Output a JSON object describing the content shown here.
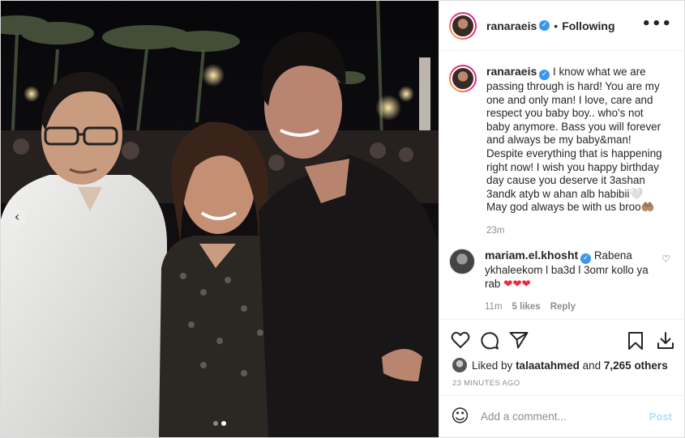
{
  "post": {
    "username": "ranaraeis",
    "separator": "•",
    "follow_status": "Following",
    "more_icon": "more-horizontal-icon"
  },
  "caption": {
    "username": "ranaraeis",
    "text": "I know what we are passing through is hard! You are my one and only man! I love, care and respect you baby boy.. who's not baby anymore. Bass you will forever and always be my baby&man! Despite everything that is happening right now! I wish you happy birthday day cause you deserve it 3ashan 3andk atyb w ahan alb habibii🤍 May god always be with us broo🤲🏽",
    "time": "23m"
  },
  "comments": [
    {
      "username": "mariam.el.khosht",
      "text": "Rabena ykhaleekom l ba3d l 3omr kollo ya rab",
      "emoji": "❤❤❤",
      "time": "11m",
      "likes": "5 likes",
      "reply": "Reply"
    }
  ],
  "likes": {
    "prefix": "Liked by",
    "user": "talaatahmed",
    "and": "and",
    "others": "7,265 others"
  },
  "timestamp": "23 MINUTES AGO",
  "comment_box": {
    "placeholder": "Add a comment...",
    "post_label": "Post"
  },
  "carousel": {
    "count": 2,
    "active_index": 2
  },
  "colors": {
    "verified": "#3897f0",
    "post_disabled": "#b2dffc",
    "heart_red": "#ed2d3d"
  }
}
